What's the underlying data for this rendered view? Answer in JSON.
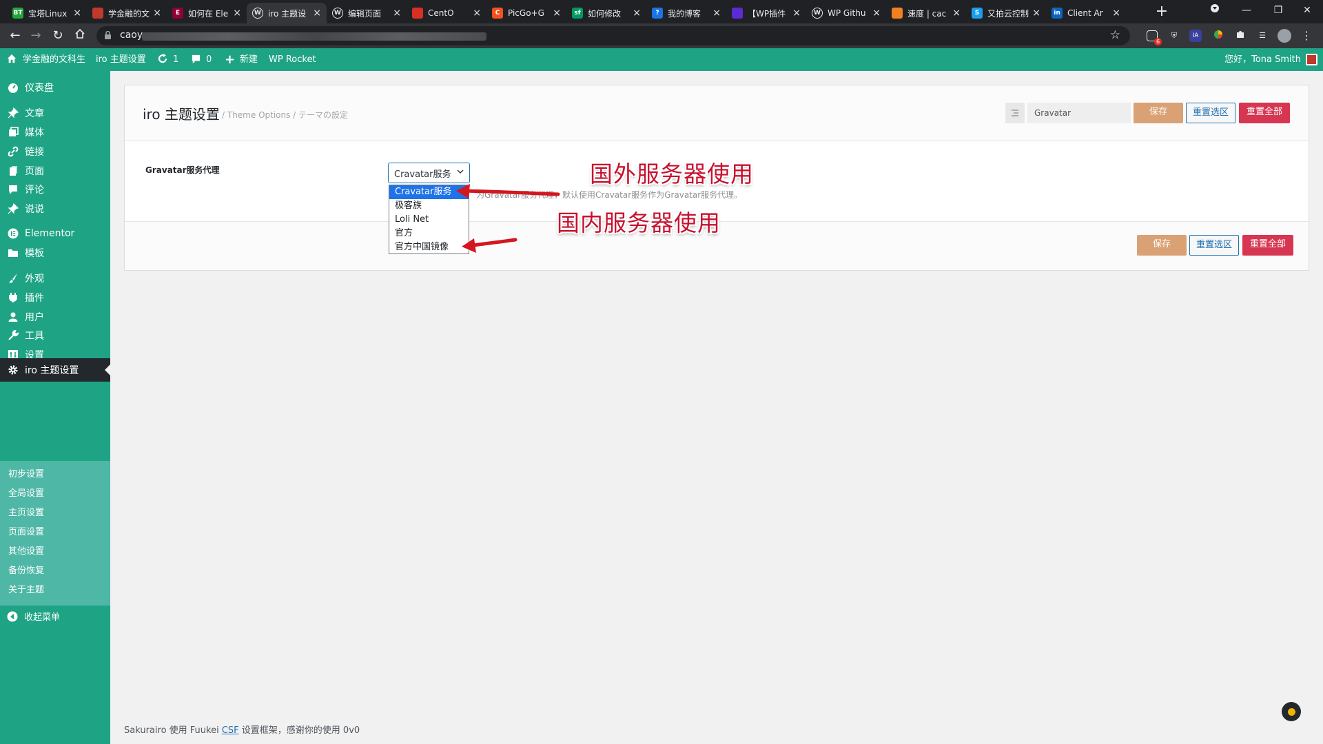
{
  "browser": {
    "tabs": [
      {
        "title": "宝塔Linux",
        "icon": "bt-icon",
        "color": "#20a53a",
        "glyph": "BT"
      },
      {
        "title": "学金融的文",
        "icon": "bookmark-icon",
        "color": "#c0392b",
        "glyph": ""
      },
      {
        "title": "如何在 Ele",
        "icon": "elementor-icon",
        "color": "#92003b",
        "glyph": "E"
      },
      {
        "title": "iro 主题设",
        "icon": "wordpress-icon",
        "color": "#ffffff",
        "glyph": "W"
      },
      {
        "title": "编辑页面",
        "icon": "wordpress-icon",
        "color": "#ffffff",
        "glyph": "W"
      },
      {
        "title": "CentO",
        "icon": "doc-icon",
        "color": "#d93025",
        "glyph": ""
      },
      {
        "title": "PicGo+G",
        "icon": "picgo-icon",
        "color": "#f4511e",
        "glyph": "C"
      },
      {
        "title": "如何修改",
        "icon": "segmentfault-icon",
        "color": "#009a61",
        "glyph": "sf"
      },
      {
        "title": "我的博客",
        "icon": "globe-icon",
        "color": "#1a73e8",
        "glyph": "?"
      },
      {
        "title": "【WP插件",
        "icon": "plugin-icon",
        "color": "#5b2bd4",
        "glyph": ""
      },
      {
        "title": "WP Githu",
        "icon": "wordpress-icon",
        "color": "#ffffff",
        "glyph": "W"
      },
      {
        "title": "速度 | cac",
        "icon": "cloudflare-icon",
        "color": "#f38020",
        "glyph": ""
      },
      {
        "title": "又拍云控制",
        "icon": "upyun-icon",
        "color": "#1a9ff0",
        "glyph": "S"
      },
      {
        "title": "Client Ar",
        "icon": "linkedin-icon",
        "color": "#0a66c2",
        "glyph": "in"
      }
    ],
    "active_tab_index": 3,
    "url_prefix": "caoy",
    "extension_badge": "6"
  },
  "adminbar": {
    "site_name": "学金融的文科生",
    "theme_settings": "iro 主题设置",
    "updates_count": "1",
    "comments_count": "0",
    "new_label": "新建",
    "wp_rocket": "WP Rocket",
    "greeting": "您好，Tona Smith"
  },
  "sidebar": {
    "items": [
      {
        "label": "仪表盘",
        "icon": "dashboard-icon"
      },
      {
        "label": "文章",
        "icon": "pushpin-icon"
      },
      {
        "label": "媒体",
        "icon": "media-icon"
      },
      {
        "label": "链接",
        "icon": "link-icon"
      },
      {
        "label": "页面",
        "icon": "page-icon"
      },
      {
        "label": "评论",
        "icon": "comment-icon"
      },
      {
        "label": "说说",
        "icon": "pushpin-icon"
      },
      {
        "label": "Elementor",
        "icon": "elementor-icon"
      },
      {
        "label": "模板",
        "icon": "folder-icon"
      },
      {
        "label": "外观",
        "icon": "brush-icon"
      },
      {
        "label": "插件",
        "icon": "plugin-icon"
      },
      {
        "label": "用户",
        "icon": "user-icon"
      },
      {
        "label": "工具",
        "icon": "wrench-icon"
      },
      {
        "label": "设置",
        "icon": "settings-icon"
      },
      {
        "label": "iro 主题设置",
        "icon": "gear-icon"
      }
    ],
    "submenu": [
      "初步设置",
      "全局设置",
      "主页设置",
      "页面设置",
      "其他设置",
      "备份恢复",
      "关于主题"
    ],
    "collapse_label": "收起菜单"
  },
  "panel": {
    "title": "iro 主题设置",
    "subtitle": "/ Theme Options / テーマの設定",
    "search_value": "Gravatar",
    "save_label": "保存",
    "reset_section_label": "重置选区",
    "reset_all_label": "重置全部",
    "field_label": "Gravatar服务代理",
    "select_value": "Cravatar服务",
    "field_desc": "为Gravatar服务代理，默认使用Cravatar服务作为Gravatar服务代理。",
    "options": [
      "Cravatar服务",
      "极客族",
      "Loli Net",
      "官方",
      "官方中国镜像"
    ],
    "selected_option_index": 0
  },
  "annotations": {
    "foreign": "国外服务器使用",
    "domestic": "国内服务器使用",
    "color": "#c8102e"
  },
  "footer": {
    "prefix": "Sakurairo 使用 Fuukei ",
    "link": "CSF",
    "suffix": " 设置框架，感谢你的使用 0v0"
  },
  "colors": {
    "wp_green": "#1ea484",
    "submenu": "#4fb7a6",
    "save": "#d9a174",
    "reset_all": "#d63651",
    "link": "#2271b1"
  }
}
